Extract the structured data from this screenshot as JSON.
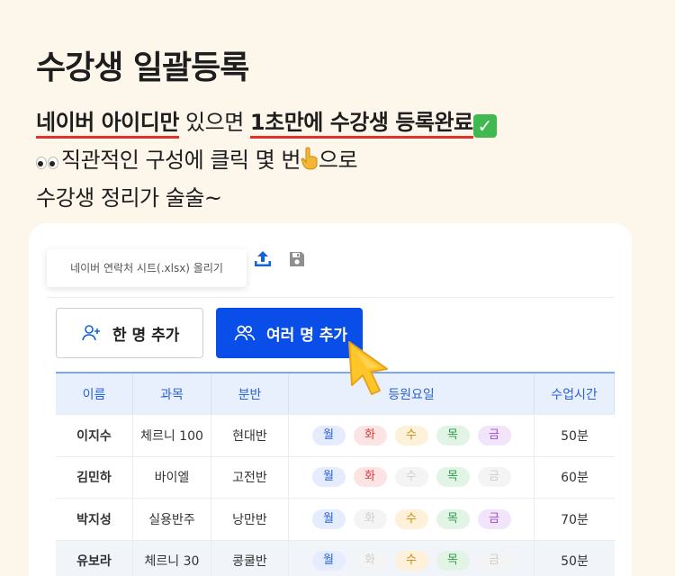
{
  "hero": {
    "title": "수강생 일괄등록",
    "line1_a": "네이버 아이디만",
    "line1_b": " 있으면 ",
    "line1_c": "1초만에 수강생 등록완료",
    "line2": "직관적인 구성에 클릭 몇 번",
    "line2_end": "으로",
    "line3": "수강생 정리가 술술~"
  },
  "toolbar": {
    "upload_tooltip": "네이버 연락처 시트(.xlsx) 올리기",
    "add_one_label": "한 명 추가",
    "add_many_label": "여러 명 추가"
  },
  "table": {
    "headers": [
      "이름",
      "과목",
      "분반",
      "등원요일",
      "수업시간"
    ],
    "day_labels": [
      "월",
      "화",
      "수",
      "목",
      "금"
    ],
    "rows": [
      {
        "name": "이지수",
        "subject": "체르니 100",
        "class": "현대반",
        "days": [
          true,
          true,
          true,
          true,
          true
        ],
        "time": "50분"
      },
      {
        "name": "김민하",
        "subject": "바이엘",
        "class": "고전반",
        "days": [
          true,
          true,
          false,
          true,
          false
        ],
        "time": "60분"
      },
      {
        "name": "박지성",
        "subject": "실용반주",
        "class": "낭만반",
        "days": [
          true,
          false,
          true,
          true,
          true
        ],
        "time": "70분"
      },
      {
        "name": "유보라",
        "subject": "체르니 30",
        "class": "콩쿨반",
        "days": [
          true,
          false,
          true,
          true,
          false
        ],
        "time": "50분"
      }
    ]
  },
  "colors": {
    "background": "#fdf6ea",
    "accent_blue": "#0a4ee9",
    "underline_red": "#e0322b",
    "cursor_yellow": "#ffc62b"
  },
  "icons": [
    "upload-icon",
    "save-icon",
    "add-person-icon",
    "add-people-icon",
    "pointer-cursor-icon",
    "check-icon",
    "eyes-icon",
    "pointing-finger-icon"
  ]
}
